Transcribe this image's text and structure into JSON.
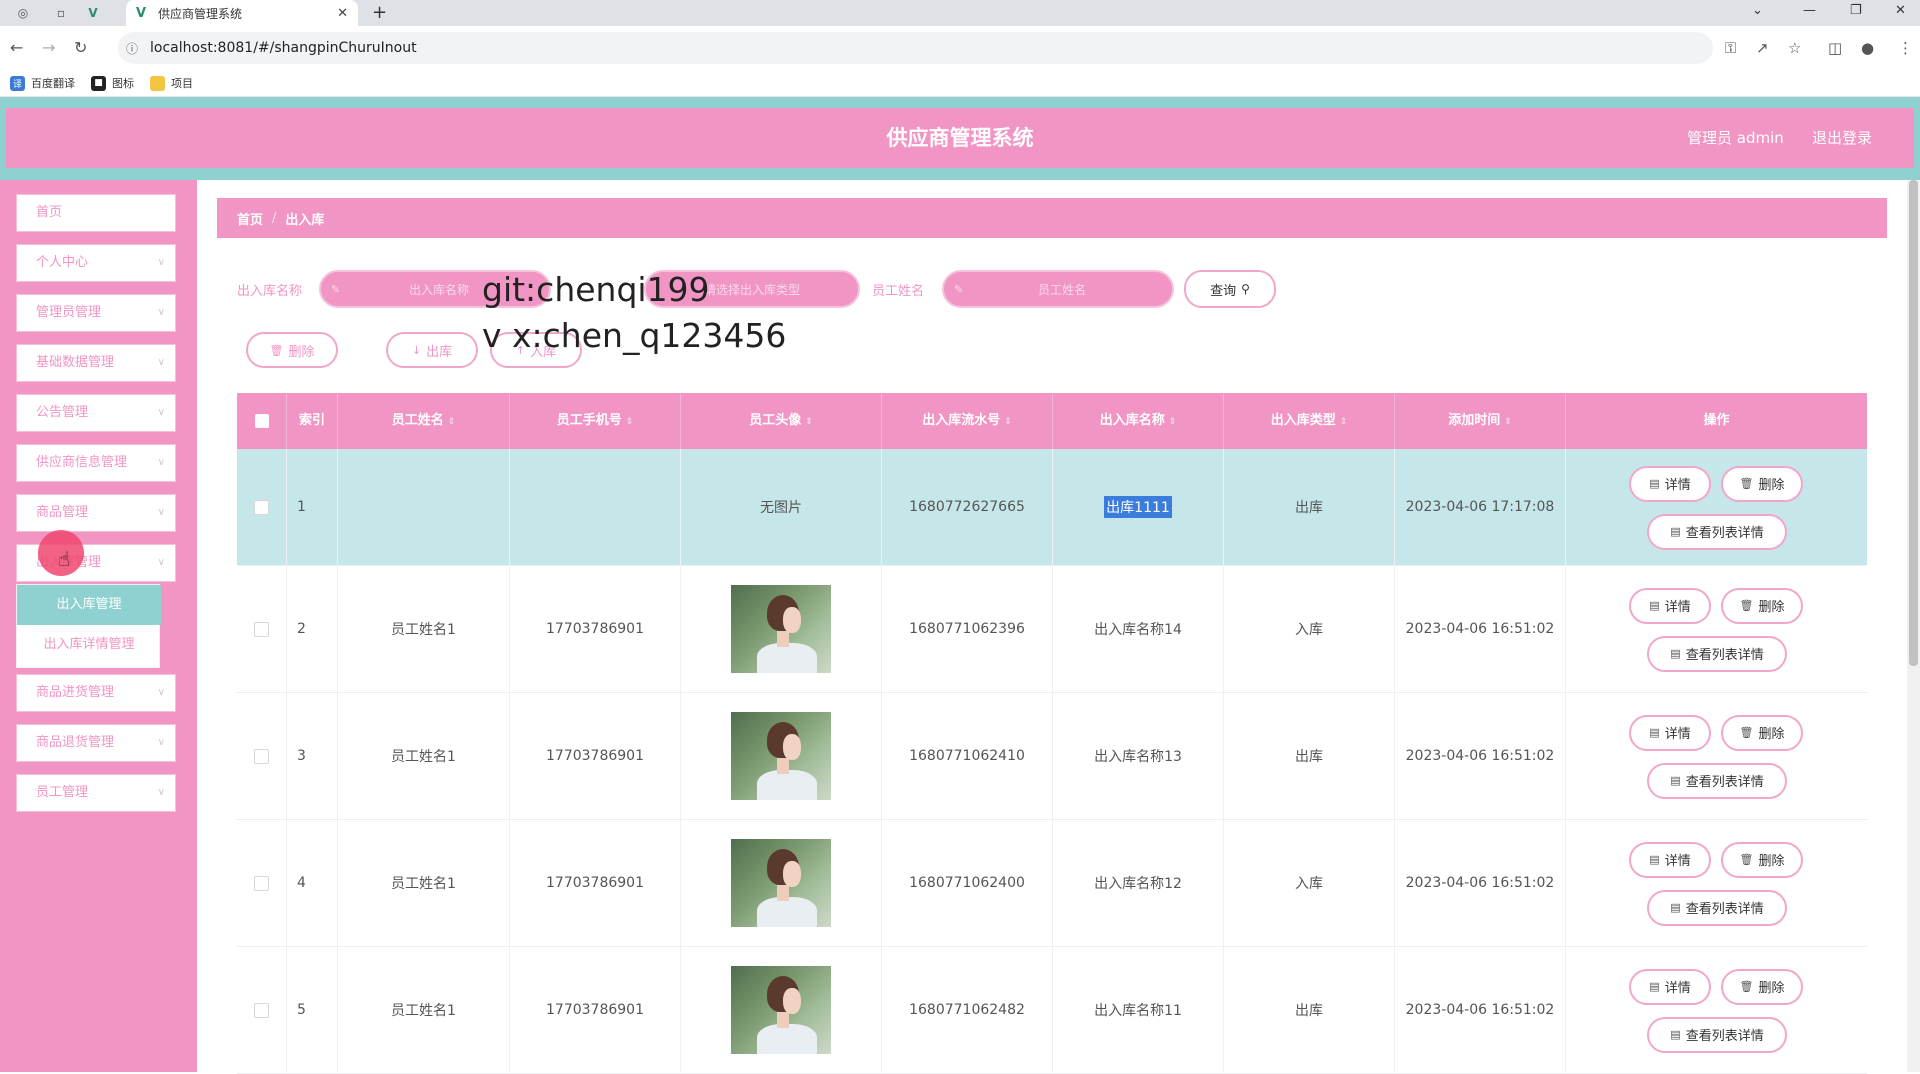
{
  "browser": {
    "tab_title": "供应商管理系统",
    "url": "localhost:8081/#/shangpinChuruInout",
    "bookmarks": [
      {
        "label": "百度翻译",
        "icon": "translate-icon",
        "color": "#3a7bd5"
      },
      {
        "label": "图标",
        "icon": "folder-icon",
        "color": "#222222"
      },
      {
        "label": "项目",
        "icon": "folder-icon",
        "color": "#f4c542"
      }
    ]
  },
  "header": {
    "title": "供应商管理系统",
    "user": "管理员 admin",
    "logout": "退出登录"
  },
  "sidebar": {
    "items": [
      {
        "label": "首页",
        "has_arrow": false
      },
      {
        "label": "个人中心",
        "has_arrow": true
      },
      {
        "label": "管理员管理",
        "has_arrow": true
      },
      {
        "label": "基础数据管理",
        "has_arrow": true
      },
      {
        "label": "公告管理",
        "has_arrow": true
      },
      {
        "label": "供应商信息管理",
        "has_arrow": true
      },
      {
        "label": "商品管理",
        "has_arrow": true
      },
      {
        "label": "出入库管理",
        "has_arrow": true
      },
      {
        "label": "商品进货管理",
        "has_arrow": true
      },
      {
        "label": "商品退货管理",
        "has_arrow": true
      },
      {
        "label": "员工管理",
        "has_arrow": true
      }
    ],
    "submenu": [
      {
        "label": "出入库管理",
        "active": true
      },
      {
        "label": "出入库详情管理",
        "active": false
      }
    ]
  },
  "breadcrumb": {
    "home": "首页",
    "current": "出入库"
  },
  "search": {
    "name_label": "出入库名称",
    "name_placeholder": "出入库名称",
    "type_placeholder": "请选择出入库类型",
    "staff_label": "员工姓名",
    "staff_placeholder": "员工姓名",
    "query_button": "查询"
  },
  "actions": {
    "delete": "删除",
    "out": "出库",
    "in": "入库"
  },
  "watermark": {
    "line1": "git:chenqi199",
    "line2": "v x:chen_q123456"
  },
  "table": {
    "headers": {
      "index": "索引",
      "staff_name": "员工姓名",
      "staff_phone": "员工手机号",
      "staff_avatar": "员工头像",
      "serial": "出入库流水号",
      "name": "出入库名称",
      "type": "出入库类型",
      "time": "添加时间",
      "ops": "操作"
    },
    "no_image": "无图片",
    "buttons": {
      "detail": "详情",
      "delete": "删除",
      "list_detail": "查看列表详情"
    },
    "rows": [
      {
        "index": "1",
        "staff_name": "",
        "staff_phone": "",
        "has_avatar": false,
        "serial": "1680772627665",
        "name": "出库1111",
        "type": "出库",
        "time": "2023-04-06 17:17:08"
      },
      {
        "index": "2",
        "staff_name": "员工姓名1",
        "staff_phone": "17703786901",
        "has_avatar": true,
        "serial": "1680771062396",
        "name": "出入库名称14",
        "type": "入库",
        "time": "2023-04-06 16:51:02"
      },
      {
        "index": "3",
        "staff_name": "员工姓名1",
        "staff_phone": "17703786901",
        "has_avatar": true,
        "serial": "1680771062410",
        "name": "出入库名称13",
        "type": "出库",
        "time": "2023-04-06 16:51:02"
      },
      {
        "index": "4",
        "staff_name": "员工姓名1",
        "staff_phone": "17703786901",
        "has_avatar": true,
        "serial": "1680771062400",
        "name": "出入库名称12",
        "type": "入库",
        "time": "2023-04-06 16:51:02"
      },
      {
        "index": "5",
        "staff_name": "员工姓名1",
        "staff_phone": "17703786901",
        "has_avatar": true,
        "serial": "1680771062482",
        "name": "出入库名称11",
        "type": "出库",
        "time": "2023-04-06 16:51:02"
      }
    ]
  },
  "colors": {
    "primary": "#f095c4",
    "accent": "#8fd1d1",
    "highlight_row": "#c6e7ea"
  }
}
